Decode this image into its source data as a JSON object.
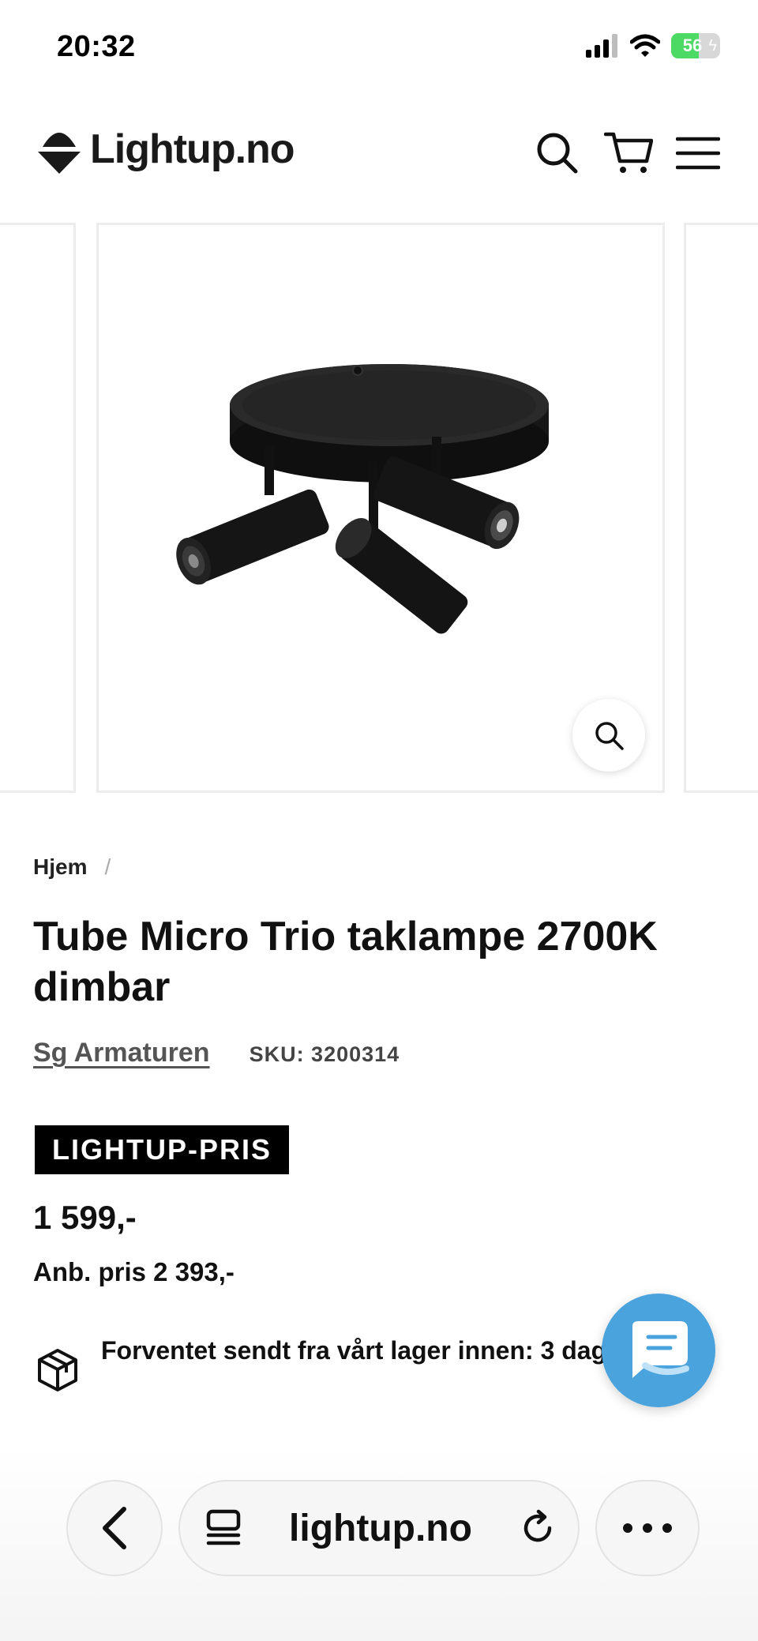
{
  "status_bar": {
    "time": "20:32",
    "battery_level": "56",
    "battery_fraction": 0.56,
    "icons": [
      "signal-icon",
      "wifi-icon",
      "battery-icon"
    ]
  },
  "header": {
    "logo_text": "Lightup.no",
    "icons": [
      "search-icon",
      "cart-icon",
      "menu-icon"
    ]
  },
  "gallery": {
    "image_alt": "Tube Micro Trio taklampe 2700K dimbar",
    "zoom_icon": "zoom-icon"
  },
  "breadcrumb": {
    "home": "Hjem",
    "separator": "/"
  },
  "product": {
    "title": "Tube Micro Trio taklampe 2700K dimbar",
    "vendor": "Sg Armaturen",
    "sku_label": "SKU: 3200314",
    "badge": "LIGHTUP-PRIS",
    "price": "1 599,-",
    "compare_price": "Anb. pris 2 393,-",
    "shipping_text": "Forventet sendt fra vårt lager innen: 3 dager"
  },
  "chat": {
    "icon": "chat-icon"
  },
  "browser": {
    "url": "lightup.no",
    "icons": [
      "back-icon",
      "tabs-icon",
      "reload-icon",
      "more-icon"
    ]
  },
  "colors": {
    "accent": "#4aa3dc",
    "badge_bg": "#000000",
    "battery": "#4cd964"
  }
}
